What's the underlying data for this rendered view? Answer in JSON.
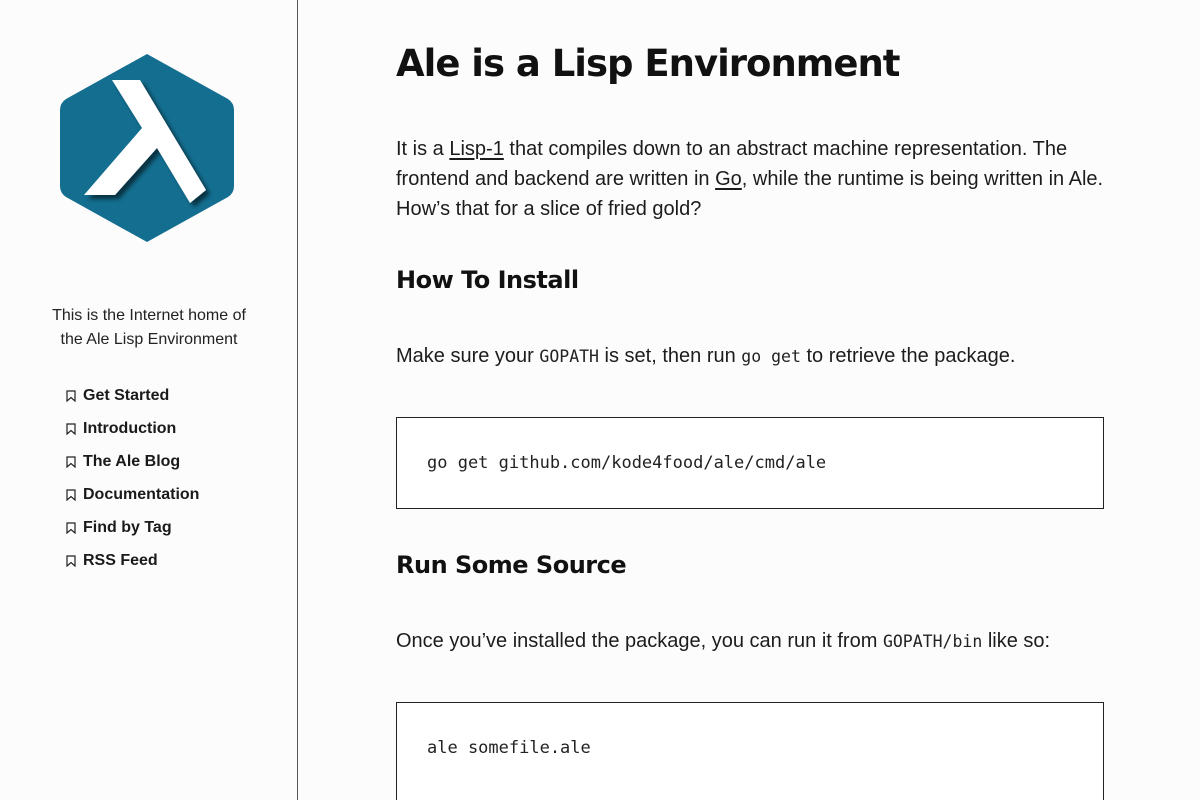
{
  "sidebar": {
    "logo_icon": "lambda-hexagon-logo",
    "logo_color": "#136e90",
    "tagline_line1": "This is the Internet home of",
    "tagline_line2": "the Ale Lisp Environment",
    "nav": [
      {
        "label": "Get Started",
        "icon": "bookmark-icon"
      },
      {
        "label": "Introduction",
        "icon": "bookmark-icon"
      },
      {
        "label": "The Ale Blog",
        "icon": "bookmark-icon"
      },
      {
        "label": "Documentation",
        "icon": "bookmark-icon"
      },
      {
        "label": "Find by Tag",
        "icon": "bookmark-icon"
      },
      {
        "label": "RSS Feed",
        "icon": "bookmark-icon"
      }
    ]
  },
  "main": {
    "title": "Ale is a Lisp Environment",
    "intro": {
      "t1": "It is a ",
      "link1": "Lisp-1",
      "t2": " that compiles down to an abstract machine representation. The frontend and backend are written in ",
      "link2": "Go",
      "t3": ", while the runtime is being written in Ale. How’s that for a slice of fried gold?"
    },
    "install": {
      "heading": "How To Install",
      "t1": "Make sure your ",
      "code1": "GOPATH",
      "t2": " is set, then run ",
      "code2": "go get",
      "t3": " to retrieve the package.",
      "command": "go get github.com/kode4food/ale/cmd/ale"
    },
    "run": {
      "heading": "Run Some Source",
      "t1": "Once you’ve installed the package, you can run it from ",
      "code1": "GOPATH/bin",
      "t2": " like so:",
      "command": "ale somefile.ale"
    }
  }
}
